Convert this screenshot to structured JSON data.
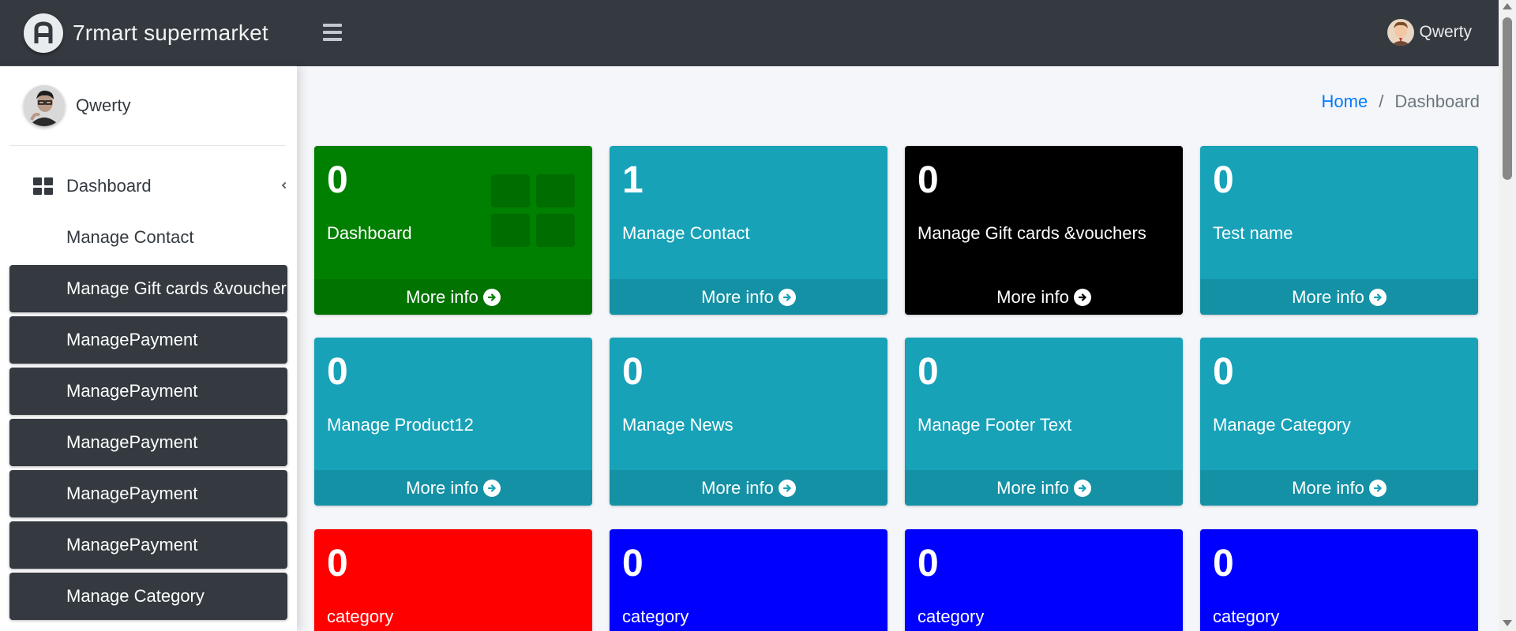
{
  "app": {
    "brand": "7rmart supermarket",
    "brand_icon": "letter-a-logo-icon"
  },
  "header": {
    "menu_icon": "hamburger-icon",
    "user_name": "Qwerty"
  },
  "sidebar": {
    "user_name": "Qwerty",
    "items": [
      {
        "label": "Dashboard",
        "icon": "dashboard-grid-icon"
      },
      {
        "label": "Manage Contact"
      },
      {
        "label": "Manage Gift cards &voucher"
      },
      {
        "label": "ManagePayment"
      },
      {
        "label": "ManagePayment"
      },
      {
        "label": "ManagePayment"
      },
      {
        "label": "ManagePayment"
      },
      {
        "label": "ManagePayment"
      },
      {
        "label": "Manage Category"
      }
    ]
  },
  "breadcrumb": {
    "home": "Home",
    "separator": "/",
    "current": "Dashboard"
  },
  "tiles": [
    {
      "count": "0",
      "title": "Dashboard",
      "more": "More info",
      "color": "#008000"
    },
    {
      "count": "1",
      "title": "Manage Contact",
      "more": "More info",
      "color": "#17a2b8"
    },
    {
      "count": "0",
      "title": "Manage Gift cards &vouchers",
      "more": "More info",
      "color": "#000000"
    },
    {
      "count": "0",
      "title": "Test name",
      "more": "More info",
      "color": "#17a2b8"
    },
    {
      "count": "0",
      "title": "Manage Product12",
      "more": "More info",
      "color": "#17a2b8"
    },
    {
      "count": "0",
      "title": "Manage News",
      "more": "More info",
      "color": "#17a2b8"
    },
    {
      "count": "0",
      "title": "Manage Footer Text",
      "more": "More info",
      "color": "#17a2b8"
    },
    {
      "count": "0",
      "title": "Manage Category",
      "more": "More info",
      "color": "#17a2b8"
    },
    {
      "count": "0",
      "title": "category",
      "color": "#ff0000"
    },
    {
      "count": "0",
      "title": "category",
      "color": "#0000ff"
    },
    {
      "count": "0",
      "title": "category",
      "color": "#0000ff"
    },
    {
      "count": "0",
      "title": "category",
      "color": "#0000ff"
    }
  ]
}
